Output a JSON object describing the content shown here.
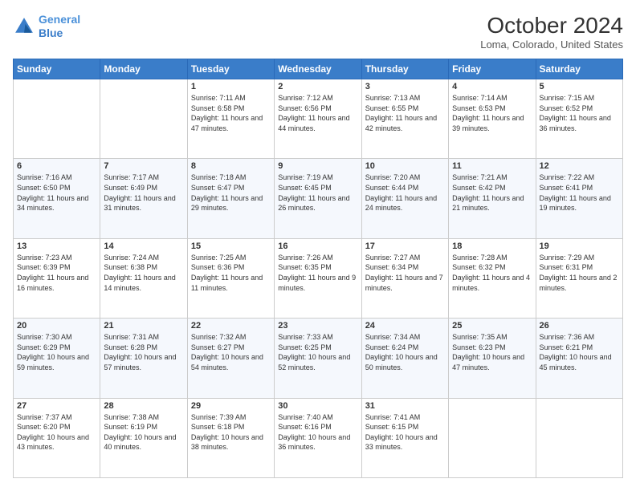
{
  "header": {
    "logo_line1": "General",
    "logo_line2": "Blue",
    "title": "October 2024",
    "subtitle": "Loma, Colorado, United States"
  },
  "days_of_week": [
    "Sunday",
    "Monday",
    "Tuesday",
    "Wednesday",
    "Thursday",
    "Friday",
    "Saturday"
  ],
  "weeks": [
    [
      {
        "day": "",
        "text": ""
      },
      {
        "day": "",
        "text": ""
      },
      {
        "day": "1",
        "text": "Sunrise: 7:11 AM\nSunset: 6:58 PM\nDaylight: 11 hours and 47 minutes."
      },
      {
        "day": "2",
        "text": "Sunrise: 7:12 AM\nSunset: 6:56 PM\nDaylight: 11 hours and 44 minutes."
      },
      {
        "day": "3",
        "text": "Sunrise: 7:13 AM\nSunset: 6:55 PM\nDaylight: 11 hours and 42 minutes."
      },
      {
        "day": "4",
        "text": "Sunrise: 7:14 AM\nSunset: 6:53 PM\nDaylight: 11 hours and 39 minutes."
      },
      {
        "day": "5",
        "text": "Sunrise: 7:15 AM\nSunset: 6:52 PM\nDaylight: 11 hours and 36 minutes."
      }
    ],
    [
      {
        "day": "6",
        "text": "Sunrise: 7:16 AM\nSunset: 6:50 PM\nDaylight: 11 hours and 34 minutes."
      },
      {
        "day": "7",
        "text": "Sunrise: 7:17 AM\nSunset: 6:49 PM\nDaylight: 11 hours and 31 minutes."
      },
      {
        "day": "8",
        "text": "Sunrise: 7:18 AM\nSunset: 6:47 PM\nDaylight: 11 hours and 29 minutes."
      },
      {
        "day": "9",
        "text": "Sunrise: 7:19 AM\nSunset: 6:45 PM\nDaylight: 11 hours and 26 minutes."
      },
      {
        "day": "10",
        "text": "Sunrise: 7:20 AM\nSunset: 6:44 PM\nDaylight: 11 hours and 24 minutes."
      },
      {
        "day": "11",
        "text": "Sunrise: 7:21 AM\nSunset: 6:42 PM\nDaylight: 11 hours and 21 minutes."
      },
      {
        "day": "12",
        "text": "Sunrise: 7:22 AM\nSunset: 6:41 PM\nDaylight: 11 hours and 19 minutes."
      }
    ],
    [
      {
        "day": "13",
        "text": "Sunrise: 7:23 AM\nSunset: 6:39 PM\nDaylight: 11 hours and 16 minutes."
      },
      {
        "day": "14",
        "text": "Sunrise: 7:24 AM\nSunset: 6:38 PM\nDaylight: 11 hours and 14 minutes."
      },
      {
        "day": "15",
        "text": "Sunrise: 7:25 AM\nSunset: 6:36 PM\nDaylight: 11 hours and 11 minutes."
      },
      {
        "day": "16",
        "text": "Sunrise: 7:26 AM\nSunset: 6:35 PM\nDaylight: 11 hours and 9 minutes."
      },
      {
        "day": "17",
        "text": "Sunrise: 7:27 AM\nSunset: 6:34 PM\nDaylight: 11 hours and 7 minutes."
      },
      {
        "day": "18",
        "text": "Sunrise: 7:28 AM\nSunset: 6:32 PM\nDaylight: 11 hours and 4 minutes."
      },
      {
        "day": "19",
        "text": "Sunrise: 7:29 AM\nSunset: 6:31 PM\nDaylight: 11 hours and 2 minutes."
      }
    ],
    [
      {
        "day": "20",
        "text": "Sunrise: 7:30 AM\nSunset: 6:29 PM\nDaylight: 10 hours and 59 minutes."
      },
      {
        "day": "21",
        "text": "Sunrise: 7:31 AM\nSunset: 6:28 PM\nDaylight: 10 hours and 57 minutes."
      },
      {
        "day": "22",
        "text": "Sunrise: 7:32 AM\nSunset: 6:27 PM\nDaylight: 10 hours and 54 minutes."
      },
      {
        "day": "23",
        "text": "Sunrise: 7:33 AM\nSunset: 6:25 PM\nDaylight: 10 hours and 52 minutes."
      },
      {
        "day": "24",
        "text": "Sunrise: 7:34 AM\nSunset: 6:24 PM\nDaylight: 10 hours and 50 minutes."
      },
      {
        "day": "25",
        "text": "Sunrise: 7:35 AM\nSunset: 6:23 PM\nDaylight: 10 hours and 47 minutes."
      },
      {
        "day": "26",
        "text": "Sunrise: 7:36 AM\nSunset: 6:21 PM\nDaylight: 10 hours and 45 minutes."
      }
    ],
    [
      {
        "day": "27",
        "text": "Sunrise: 7:37 AM\nSunset: 6:20 PM\nDaylight: 10 hours and 43 minutes."
      },
      {
        "day": "28",
        "text": "Sunrise: 7:38 AM\nSunset: 6:19 PM\nDaylight: 10 hours and 40 minutes."
      },
      {
        "day": "29",
        "text": "Sunrise: 7:39 AM\nSunset: 6:18 PM\nDaylight: 10 hours and 38 minutes."
      },
      {
        "day": "30",
        "text": "Sunrise: 7:40 AM\nSunset: 6:16 PM\nDaylight: 10 hours and 36 minutes."
      },
      {
        "day": "31",
        "text": "Sunrise: 7:41 AM\nSunset: 6:15 PM\nDaylight: 10 hours and 33 minutes."
      },
      {
        "day": "",
        "text": ""
      },
      {
        "day": "",
        "text": ""
      }
    ]
  ]
}
